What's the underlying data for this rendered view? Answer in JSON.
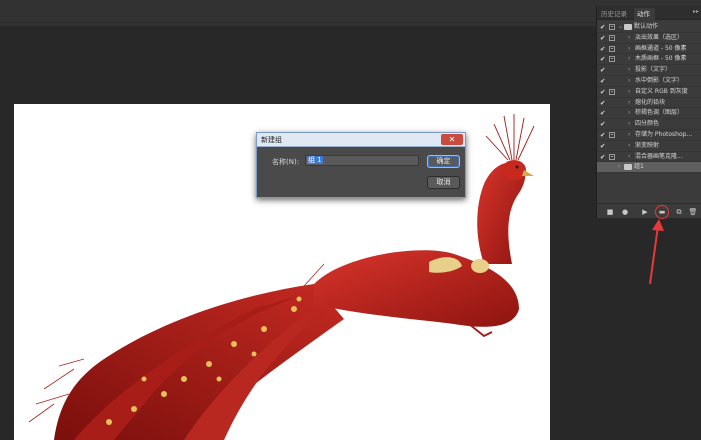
{
  "actions_panel": {
    "tabs": [
      "历史记录",
      "动作"
    ],
    "active_tab": 1,
    "menu_icon": "panel-menu-icon",
    "rows": [
      {
        "kind": "set",
        "label": "默认动作",
        "checked": true,
        "dialog": true
      },
      {
        "kind": "action",
        "label": "淡出效果（选区）",
        "checked": true,
        "dialog": true
      },
      {
        "kind": "action",
        "label": "画框通道 - 50 像素",
        "checked": true,
        "dialog": true
      },
      {
        "kind": "action",
        "label": "木质画框 - 50 像素",
        "checked": true,
        "dialog": true
      },
      {
        "kind": "action",
        "label": "投影（文字）",
        "checked": true,
        "dialog": false
      },
      {
        "kind": "action",
        "label": "水中倒影（文字）",
        "checked": true,
        "dialog": false
      },
      {
        "kind": "action",
        "label": "自定义 RGB 到灰度",
        "checked": true,
        "dialog": true
      },
      {
        "kind": "action",
        "label": "熔化的铅块",
        "checked": true,
        "dialog": false
      },
      {
        "kind": "action",
        "label": "棕褐色调（图层）",
        "checked": true,
        "dialog": false
      },
      {
        "kind": "action",
        "label": "四分颜色",
        "checked": true,
        "dialog": false
      },
      {
        "kind": "action",
        "label": "存储为 Photoshop...",
        "checked": true,
        "dialog": true
      },
      {
        "kind": "action",
        "label": "渐变映射",
        "checked": true,
        "dialog": false
      },
      {
        "kind": "action",
        "label": "混合器画笔克隆...",
        "checked": true,
        "dialog": true
      },
      {
        "kind": "set",
        "label": "组1",
        "checked": false,
        "dialog": false,
        "selected": true
      }
    ],
    "footer_buttons": [
      {
        "name": "stop-icon",
        "glyph": "■"
      },
      {
        "name": "record-icon",
        "glyph": "●"
      },
      {
        "name": "play-icon",
        "glyph": "▶"
      },
      {
        "name": "new-set-folder-icon",
        "glyph": "▬"
      },
      {
        "name": "new-action-icon",
        "glyph": "⧉"
      },
      {
        "name": "delete-icon",
        "glyph": "🗑"
      }
    ]
  },
  "dialog": {
    "title": "新建组",
    "close_glyph": "✕",
    "name_label": "名称(N):",
    "name_value": "组 1",
    "ok_label": "确定",
    "cancel_label": "取消"
  },
  "colors": {
    "workspace": "#282828",
    "panel": "#3b3b3b",
    "annotation_red": "#e33a3a",
    "dialog_border": "#7a9cc9"
  }
}
